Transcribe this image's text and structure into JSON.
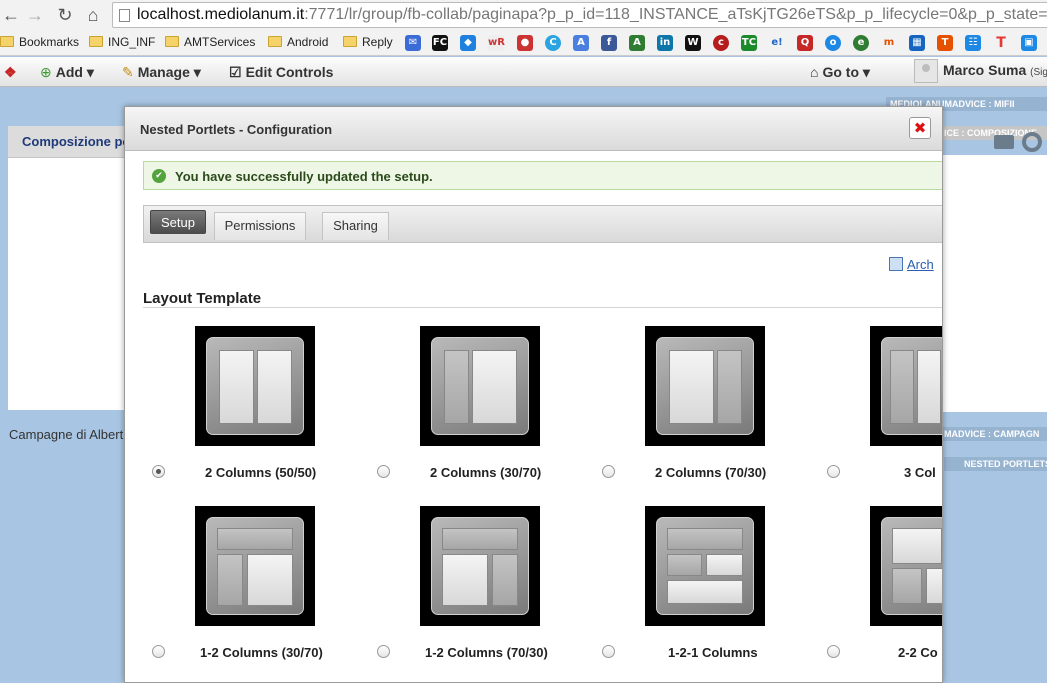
{
  "browser": {
    "url_host": "localhost.mediolanum.it",
    "url_path": ":7771/lr/group/fb-collab/paginapa?p_p_id=118_INSTANCE_aTsKjTG26eTS&p_p_lifecycle=0&p_p_state=nc",
    "bookmarks": [
      {
        "label": "Bookmarks"
      },
      {
        "label": "ING_INF"
      },
      {
        "label": "AMTServices"
      },
      {
        "label": "Android"
      },
      {
        "label": "Reply"
      }
    ],
    "bookmark_icons": [
      "mail-icon",
      "fc-icon",
      "dropbox-icon",
      "wr-icon",
      "flag-icon",
      "circle-icon",
      "translate-icon",
      "facebook-icon",
      "a-icon",
      "linkedin-icon",
      "w-icon",
      "mc-icon",
      "tc-icon",
      "e-icon",
      "q-icon",
      "o-icon",
      "e2-icon",
      "m-icon",
      "m2-icon",
      "t-icon",
      "feed-icon",
      "t2-icon",
      "img-icon",
      "pdf-icon"
    ]
  },
  "dockbar": {
    "add": "Add",
    "manage": "Manage",
    "edit_controls": "Edit Controls",
    "goto": "Go to",
    "user": "Marco Suma",
    "signout": "(Sign"
  },
  "page": {
    "portlet_title": "Composizione po",
    "campagne": "Campagne di Albert",
    "tags": [
      "MEDIOLANUMADVICE : MIFII",
      "ICE : COMPOSIZIONE",
      "MADVICE : CAMPAGN",
      "NESTED PORTLETS"
    ]
  },
  "modal": {
    "title": "Nested Portlets - Configuration",
    "success": "You have successfully updated the setup.",
    "tabs": [
      "Setup",
      "Permissions",
      "Sharing"
    ],
    "archive": "Arch",
    "section_title": "Layout Template",
    "layouts": [
      {
        "label": "2 Columns (50/50)",
        "selected": true
      },
      {
        "label": "2 Columns (30/70)",
        "selected": false
      },
      {
        "label": "2 Columns (70/30)",
        "selected": false
      },
      {
        "label": "3 Col",
        "selected": false
      },
      {
        "label": "1-2 Columns (30/70)",
        "selected": false
      },
      {
        "label": "1-2 Columns (70/30)",
        "selected": false
      },
      {
        "label": "1-2-1 Columns",
        "selected": false
      },
      {
        "label": "2-2 Co",
        "selected": false
      }
    ]
  },
  "colors": {
    "accent_link": "#2a5db0",
    "success_bg": "#eef7e5",
    "close_red": "#dd1111",
    "page_bg": "#a8c6e3"
  }
}
